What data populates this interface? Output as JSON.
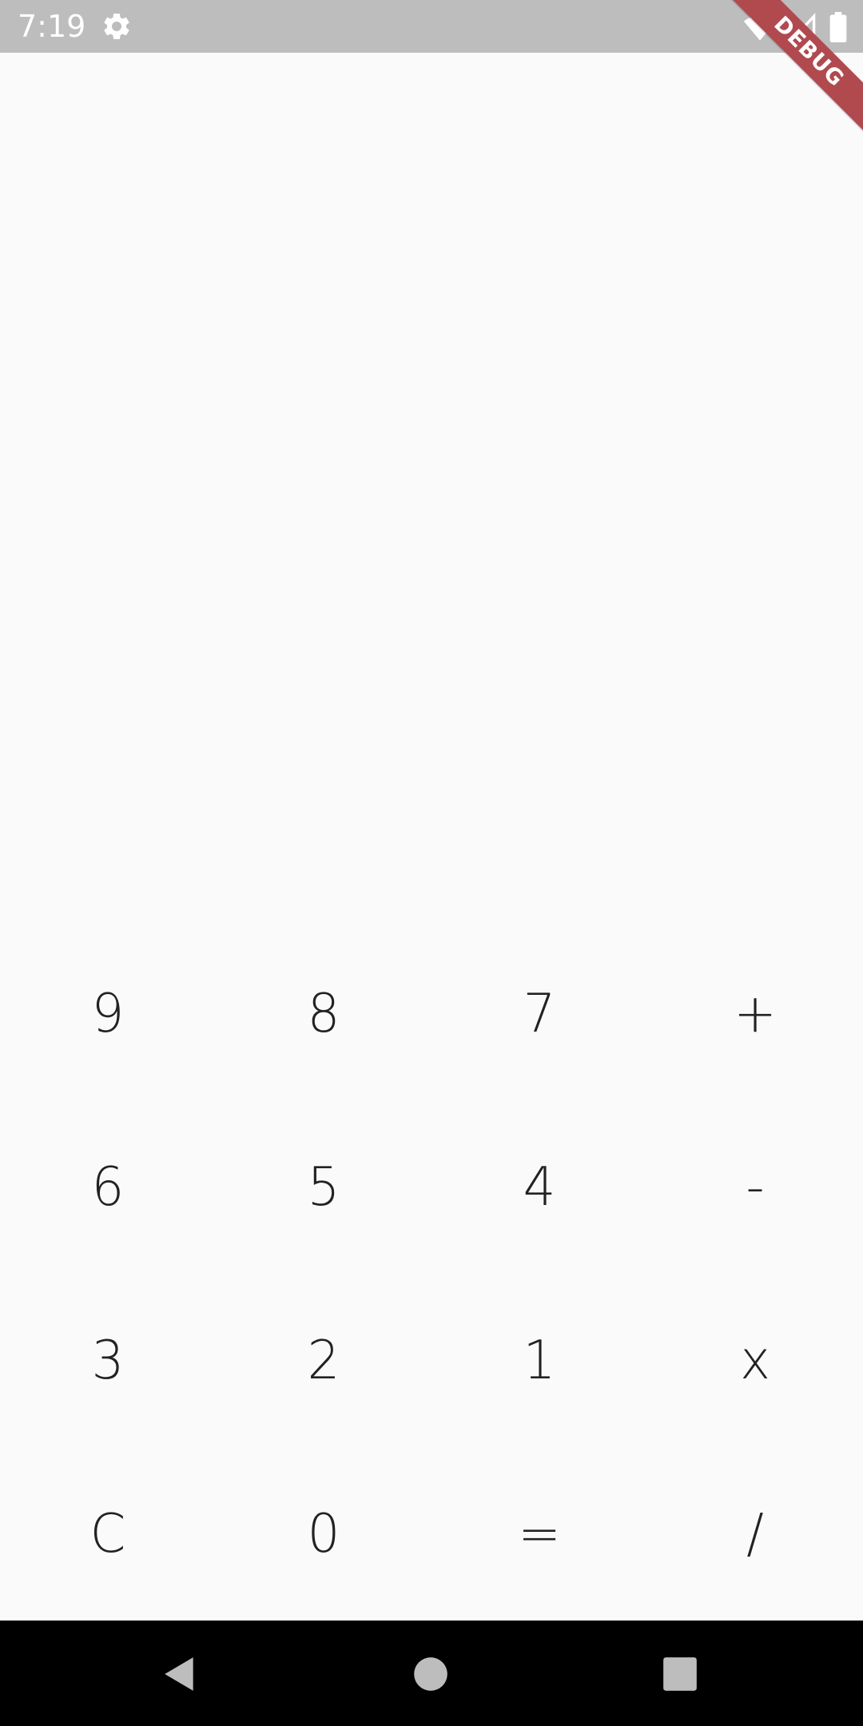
{
  "status_bar": {
    "time": "7:19",
    "icons": [
      "settings-icon",
      "wifi-icon",
      "signal-icon",
      "battery-icon"
    ]
  },
  "debug_banner": {
    "label": "DEBUG",
    "color": "#b04a4f"
  },
  "display": {
    "value": ""
  },
  "keypad": {
    "rows": [
      [
        "9",
        "8",
        "7",
        "+"
      ],
      [
        "6",
        "5",
        "4",
        "-"
      ],
      [
        "3",
        "2",
        "1",
        "x"
      ],
      [
        "C",
        "0",
        "=",
        "/"
      ]
    ]
  },
  "nav_bar": {
    "buttons": [
      "back-icon",
      "home-icon",
      "recents-icon"
    ]
  },
  "colors": {
    "status_bar_bg": "#bdbdbd",
    "background": "#fafafa",
    "key_text": "#222222",
    "nav_bar_bg": "#000000"
  }
}
